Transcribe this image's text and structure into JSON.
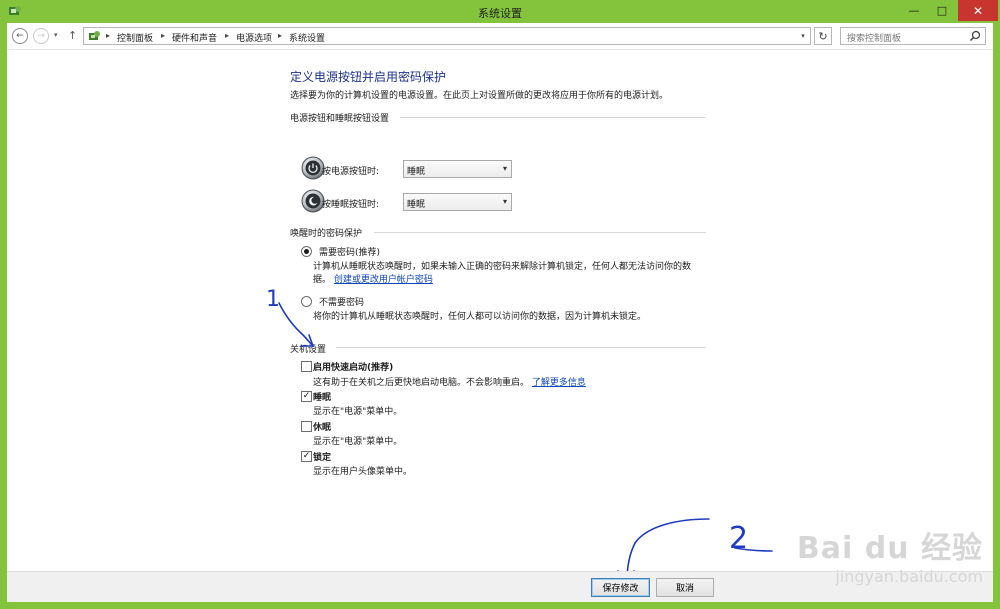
{
  "window": {
    "title": "系统设置",
    "minimize": "—",
    "maximize": "□",
    "close": "✕",
    "frame_color": "#84c43c"
  },
  "nav": {
    "back": "←",
    "forward": "→",
    "recent": "▾",
    "up": "↑",
    "breadcrumbs": [
      "控制面板",
      "硬件和声音",
      "电源选项",
      "系统设置"
    ],
    "separator": "▸",
    "dropdown": "▾",
    "refresh": "↻",
    "search_placeholder": "搜索控制面板"
  },
  "page": {
    "heading": "定义电源按钮并启用密码保护",
    "subheading": "选择要为你的计算机设置的电源设置。在此页上对设置所做的更改将应用于你所有的电源计划。"
  },
  "power_section": {
    "title": "电源按钮和睡眠按钮设置",
    "power_button_label": "按电源按钮时:",
    "power_button_value": "睡眠",
    "sleep_button_label": "按睡眠按钮时:",
    "sleep_button_value": "睡眠"
  },
  "password_section": {
    "title": "唤醒时的密码保护",
    "require_label": "需要密码(推荐)",
    "require_selected": true,
    "require_desc_line1": "计算机从睡眠状态唤醒时，如果未输入正确的密码来解除计算机锁定，任何人都无法访问你的数",
    "require_desc_line2_prefix": "据。",
    "require_link": "创建或更改用户帐户密码",
    "no_require_label": "不需要密码",
    "no_require_selected": false,
    "no_require_desc": "将你的计算机从睡眠状态唤醒时，任何人都可以访问你的数据，因为计算机未锁定。"
  },
  "shutdown_section": {
    "title": "关机设置",
    "fast_startup_label": "启用快速启动(推荐)",
    "fast_startup_checked": false,
    "fast_startup_desc": "这有助于在关机之后更快地启动电脑。不会影响重启。",
    "fast_startup_link": "了解更多信息",
    "sleep_label": "睡眠",
    "sleep_checked": true,
    "sleep_desc": "显示在\"电源\"菜单中。",
    "hibernate_label": "休眠",
    "hibernate_checked": false,
    "hibernate_desc": "显示在\"电源\"菜单中。",
    "lock_label": "锁定",
    "lock_checked": true,
    "lock_desc": "显示在用户头像菜单中。"
  },
  "footer": {
    "save_label": "保存修改",
    "cancel_label": "取消"
  },
  "annotations": {
    "mark_1": "1",
    "mark_2": "2",
    "ink_color": "#1f3bc4"
  },
  "watermark": {
    "main": "Bai du 经验",
    "sub": "jingyan.baidu.com"
  }
}
